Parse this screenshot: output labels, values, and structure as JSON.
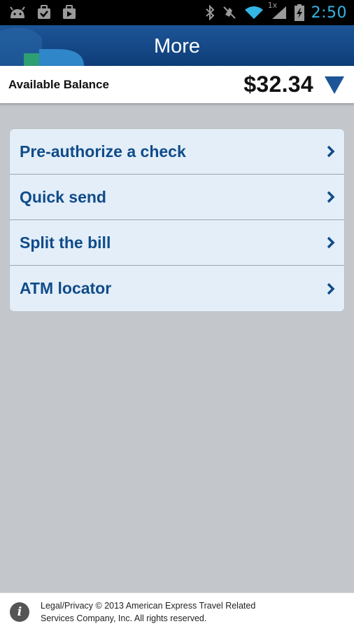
{
  "status_bar": {
    "time": "2:50",
    "signal_label": "1x",
    "left_icons": [
      "android-debug-icon",
      "checkbox-download-icon",
      "play-store-icon"
    ],
    "right_icons": [
      "bluetooth-icon",
      "vibrate-off-icon",
      "wifi-icon",
      "signal-icon",
      "battery-charging-icon"
    ],
    "accent_color": "#33b5e5"
  },
  "header": {
    "title": "More",
    "background_color": "#174b8a"
  },
  "balance": {
    "label": "Available Balance",
    "amount": "$32.34",
    "toggle_icon": "triangle-down-icon"
  },
  "menu": {
    "items": [
      {
        "label": "Pre-authorize a check"
      },
      {
        "label": "Quick send"
      },
      {
        "label": "Split the bill"
      },
      {
        "label": "ATM locator"
      }
    ],
    "text_color": "#0f4c8a",
    "background_color": "#e4eef8"
  },
  "footer": {
    "line1": "Legal/Privacy © 2013 American Express Travel Related",
    "line2": "Services Company, Inc. All rights reserved.",
    "info_glyph": "i"
  }
}
